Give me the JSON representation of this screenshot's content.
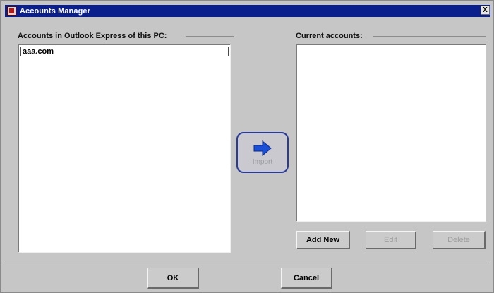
{
  "window": {
    "title": "Accounts Manager",
    "close_glyph": "X"
  },
  "left_panel": {
    "label": "Accounts in Outlook Express of this PC:",
    "items": [
      "aaa.com"
    ]
  },
  "import_button": {
    "label": "Import",
    "icon": "arrow-right-icon",
    "enabled": false
  },
  "right_panel": {
    "label": "Current accounts:",
    "items": []
  },
  "actions": {
    "add_new": "Add New",
    "edit": "Edit",
    "delete": "Delete"
  },
  "dialog": {
    "ok": "OK",
    "cancel": "Cancel"
  },
  "colors": {
    "titlebar": "#0a1f8c",
    "arrow": "#1a4fd6",
    "import_border": "#2a3a9a"
  }
}
